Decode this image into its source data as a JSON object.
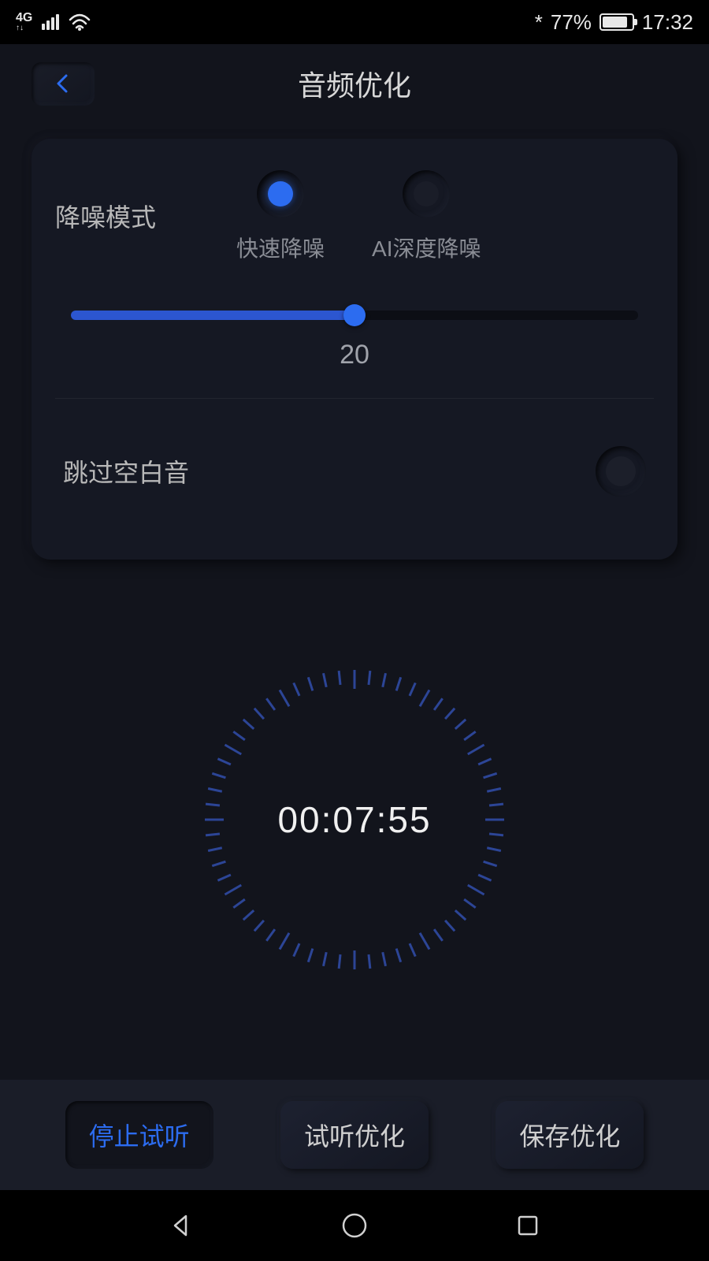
{
  "status": {
    "network": "4G",
    "bluetooth_icon": "*",
    "battery_pct": "77%",
    "time": "17:32"
  },
  "header": {
    "title": "音频优化"
  },
  "noise": {
    "label": "降噪模式",
    "options": [
      "快速降噪",
      "AI深度降噪"
    ],
    "selected_index": 0,
    "slider_value": "20",
    "slider_pct": 50
  },
  "skip": {
    "label": "跳过空白音",
    "enabled": false
  },
  "timer": {
    "display": "00:07:55"
  },
  "buttons": {
    "stop": "停止试听",
    "preview": "试听优化",
    "save": "保存优化"
  }
}
